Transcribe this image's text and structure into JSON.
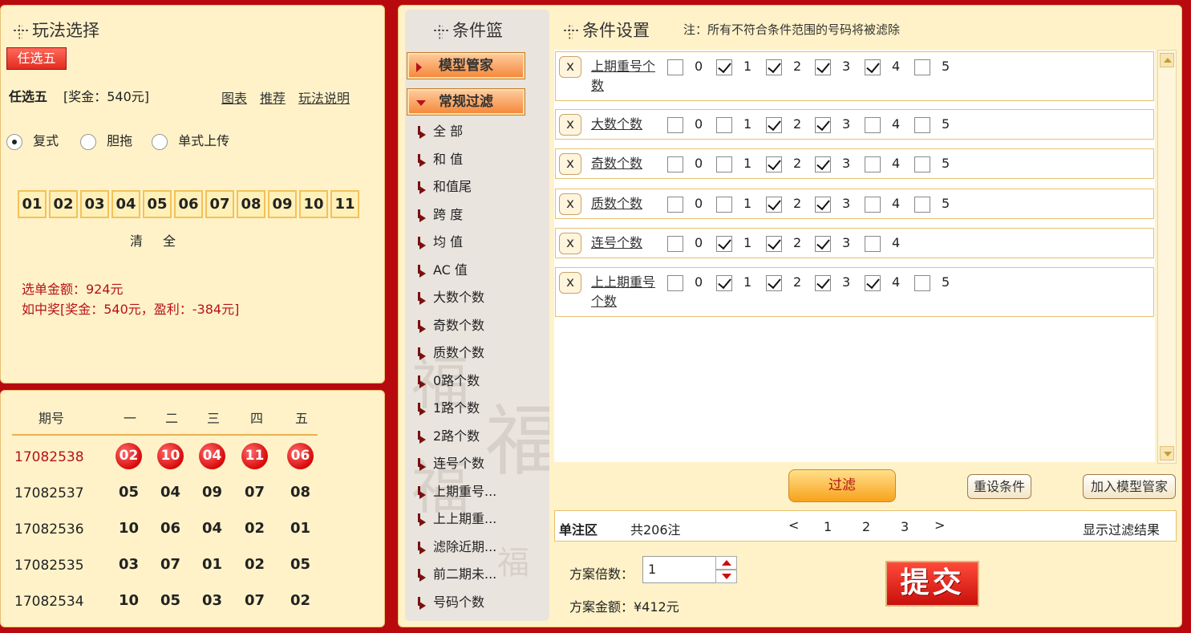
{
  "play": {
    "title": "玩法选择",
    "tab": "任选五",
    "name": "任选五",
    "prize_text": "[奖金：540元]",
    "links": [
      "图表",
      "推荐",
      "玩法说明"
    ],
    "modes": [
      {
        "label": "复式",
        "selected": true
      },
      {
        "label": "胆拖",
        "selected": false
      },
      {
        "label": "单式上传",
        "selected": false
      }
    ],
    "numbers": [
      "01",
      "02",
      "03",
      "04",
      "05",
      "06",
      "07",
      "08",
      "09",
      "10",
      "11"
    ],
    "clear": "清",
    "all": "全",
    "amount_text": "选单金额：924元",
    "win_text": "如中奖[奖金：540元，盈利：-384元]"
  },
  "draws": {
    "headers": [
      "期号",
      "一",
      "二",
      "三",
      "四",
      "五"
    ],
    "rows": [
      {
        "issue": "17082538",
        "nums": [
          "02",
          "10",
          "04",
          "11",
          "06"
        ]
      },
      {
        "issue": "17082537",
        "nums": [
          "05",
          "04",
          "09",
          "07",
          "08"
        ]
      },
      {
        "issue": "17082536",
        "nums": [
          "10",
          "06",
          "04",
          "02",
          "01"
        ]
      },
      {
        "issue": "17082535",
        "nums": [
          "03",
          "07",
          "01",
          "02",
          "05"
        ]
      },
      {
        "issue": "17082534",
        "nums": [
          "10",
          "05",
          "03",
          "07",
          "02"
        ]
      }
    ]
  },
  "basket": {
    "title": "条件篮",
    "model_btn": "模型管家",
    "filter_btn": "常规过滤",
    "watermark": [
      "福",
      "福",
      "福",
      "福"
    ],
    "items": [
      "全 部",
      "和 值",
      "和值尾",
      "跨 度",
      "均 值",
      "AC 值",
      "大数个数",
      "奇数个数",
      "质数个数",
      "0路个数",
      "1路个数",
      "2路个数",
      "连号个数",
      "上期重号...",
      "上上期重...",
      "滤除近期...",
      "前二期未...",
      "号码个数"
    ]
  },
  "conditions": {
    "title": "条件设置",
    "note": "注：所有不符合条件范围的号码将被滤除",
    "remove": "x",
    "rows": [
      {
        "label": "上期重号个数",
        "values": [
          "0",
          "1",
          "2",
          "3",
          "4",
          "5"
        ],
        "checked": [
          false,
          true,
          true,
          true,
          true,
          false
        ]
      },
      {
        "label": "大数个数",
        "values": [
          "0",
          "1",
          "2",
          "3",
          "4",
          "5"
        ],
        "checked": [
          false,
          false,
          true,
          true,
          false,
          false
        ]
      },
      {
        "label": "奇数个数",
        "values": [
          "0",
          "1",
          "2",
          "3",
          "4",
          "5"
        ],
        "checked": [
          false,
          false,
          true,
          true,
          false,
          false
        ]
      },
      {
        "label": "质数个数",
        "values": [
          "0",
          "1",
          "2",
          "3",
          "4",
          "5"
        ],
        "checked": [
          false,
          false,
          true,
          true,
          false,
          false
        ]
      },
      {
        "label": "连号个数",
        "values": [
          "0",
          "1",
          "2",
          "3",
          "4"
        ],
        "checked": [
          false,
          true,
          true,
          true,
          false
        ]
      },
      {
        "label": "上上期重号个数",
        "values": [
          "0",
          "1",
          "2",
          "3",
          "4",
          "5"
        ],
        "checked": [
          false,
          true,
          true,
          true,
          true,
          false
        ]
      }
    ]
  },
  "actions": {
    "filter": "过滤",
    "reset": "重设条件",
    "add_model": "加入模型管家"
  },
  "pager": {
    "zone": "单注区",
    "total": "共206注",
    "prev": "<",
    "pages": [
      "1",
      "2",
      "3"
    ],
    "next": ">",
    "show": "显示过滤结果"
  },
  "scheme": {
    "mult_label": "方案倍数：",
    "mult_value": "1",
    "amount_label": "方案金额：¥412元",
    "submit": "提交"
  }
}
